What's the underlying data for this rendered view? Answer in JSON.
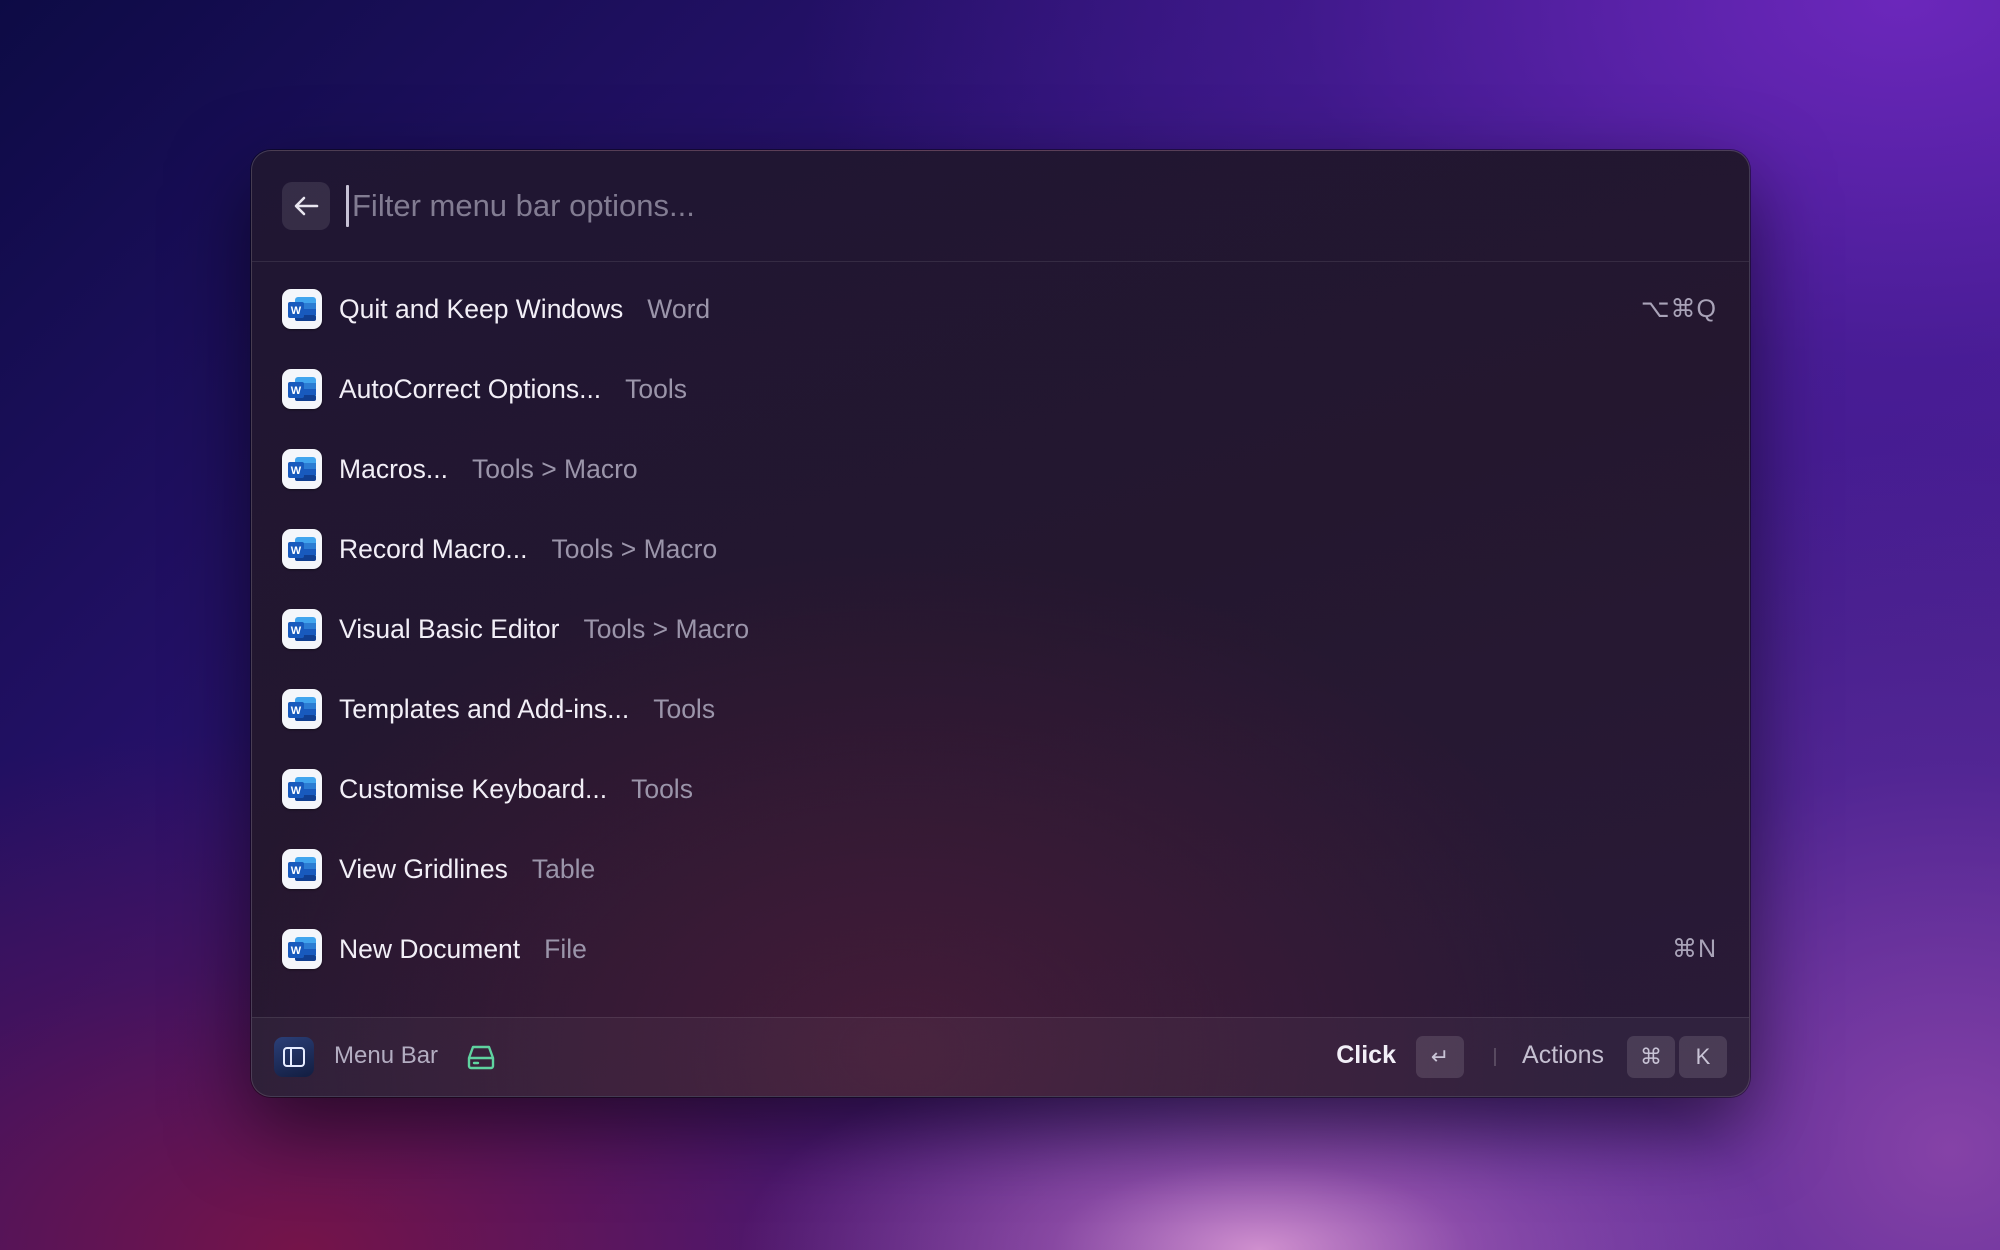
{
  "search": {
    "placeholder": "Filter menu bar options...",
    "value": ""
  },
  "items": [
    {
      "title": "Quit and Keep Windows",
      "subtitle": "Word",
      "shortcut": "⌥⌘Q",
      "icon": "word-app-icon"
    },
    {
      "title": "AutoCorrect Options...",
      "subtitle": "Tools",
      "shortcut": "",
      "icon": "word-app-icon"
    },
    {
      "title": "Macros...",
      "subtitle": "Tools > Macro",
      "shortcut": "",
      "icon": "word-app-icon"
    },
    {
      "title": "Record Macro...",
      "subtitle": "Tools > Macro",
      "shortcut": "",
      "icon": "word-app-icon"
    },
    {
      "title": "Visual Basic Editor",
      "subtitle": "Tools > Macro",
      "shortcut": "",
      "icon": "word-app-icon"
    },
    {
      "title": "Templates and Add-ins...",
      "subtitle": "Tools",
      "shortcut": "",
      "icon": "word-app-icon"
    },
    {
      "title": "Customise Keyboard...",
      "subtitle": "Tools",
      "shortcut": "",
      "icon": "word-app-icon"
    },
    {
      "title": "View Gridlines",
      "subtitle": "Table",
      "shortcut": "",
      "icon": "word-app-icon"
    },
    {
      "title": "New Document",
      "subtitle": "File",
      "shortcut": "⌘N",
      "icon": "word-app-icon"
    }
  ],
  "footer": {
    "extension_label": "Menu Bar",
    "primary_action": "Click",
    "enter_key": "↵",
    "actions_label": "Actions",
    "cmd_key": "⌘",
    "k_key": "K"
  },
  "colors": {
    "word_blue": "#2b5fbf",
    "storage_icon": "#5fd3a0",
    "accent_text": "#f2eff7",
    "muted_text": "#9b95aa"
  }
}
